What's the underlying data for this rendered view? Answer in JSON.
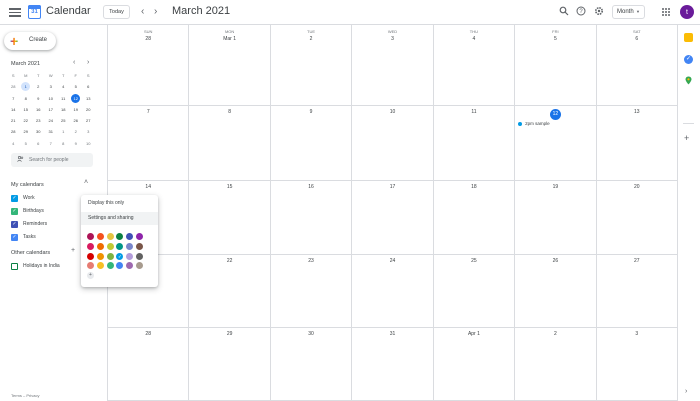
{
  "header": {
    "app_title": "Calendar",
    "logo_day": "31",
    "today_label": "Today",
    "prev_icon": "chevron-left-icon",
    "next_icon": "chevron-right-icon",
    "month_title": "March 2021",
    "view_label": "Month",
    "account_initial": "t",
    "account_color": "#6a1b9a"
  },
  "sidebar": {
    "create_label": "Create",
    "mini_title": "March 2021",
    "mini_dow": [
      "S",
      "M",
      "T",
      "W",
      "T",
      "F",
      "S"
    ],
    "mini_days": [
      "28",
      "1",
      "2",
      "3",
      "4",
      "5",
      "6",
      "7",
      "8",
      "9",
      "10",
      "11",
      "12",
      "13",
      "14",
      "15",
      "16",
      "17",
      "18",
      "19",
      "20",
      "21",
      "22",
      "23",
      "24",
      "25",
      "26",
      "27",
      "28",
      "29",
      "30",
      "31",
      "1",
      "2",
      "3",
      "4",
      "5",
      "6",
      "7",
      "8",
      "9",
      "10"
    ],
    "search_placeholder": "Search for people",
    "my_calendars_title": "My calendars",
    "calendars": [
      {
        "label": "Work",
        "color": "#039be5",
        "checked": true
      },
      {
        "label": "Birthdays",
        "color": "#33b679",
        "checked": true
      },
      {
        "label": "Reminders",
        "color": "#3f51b5",
        "checked": true
      },
      {
        "label": "Tasks",
        "color": "#4285f4",
        "checked": true
      }
    ],
    "other_calendars_title": "Other calendars",
    "other_calendars": [
      {
        "label": "Holidays in India",
        "color": "#0b8043",
        "checked": false
      }
    ],
    "footer": "Terms – Privacy"
  },
  "grid": {
    "dow": [
      "SUN",
      "MON",
      "TUE",
      "WED",
      "THU",
      "FRI",
      "SAT"
    ],
    "weeks": [
      [
        "28",
        "Mar 1",
        "2",
        "3",
        "4",
        "5",
        "6"
      ],
      [
        "7",
        "8",
        "9",
        "10",
        "11",
        "12",
        "13"
      ],
      [
        "14",
        "15",
        "16",
        "17",
        "18",
        "19",
        "20"
      ],
      [
        "21",
        "22",
        "23",
        "24",
        "25",
        "26",
        "27"
      ],
      [
        "28",
        "29",
        "30",
        "31",
        "Apr 1",
        "2",
        "3"
      ]
    ],
    "today": "12",
    "event": {
      "label": "2pm sample",
      "color": "#039be5"
    }
  },
  "popup": {
    "display_only": "Display this only",
    "settings_sharing": "Settings and sharing",
    "add_icon": "+",
    "swatches": [
      "#ad1457",
      "#f4511e",
      "#e4c441",
      "#0b8043",
      "#3f51b5",
      "#8e24aa",
      "#d81b60",
      "#ef6c00",
      "#c0ca33",
      "#009688",
      "#7986cb",
      "#795548",
      "#d50000",
      "#f09300",
      "#7cb342",
      "#039be5",
      "#b39ddb",
      "#616161",
      "#e67c73",
      "#f6bf26",
      "#33b679",
      "#4285f4",
      "#9e69af",
      "#a79b8e"
    ],
    "selected_swatch": 15
  },
  "rail": {
    "icons": [
      {
        "name": "keep-icon",
        "color": "#fbbc04"
      },
      {
        "name": "tasks-icon",
        "color": "#4285f4"
      },
      {
        "name": "maps-icon",
        "color": "#34a853"
      }
    ]
  }
}
